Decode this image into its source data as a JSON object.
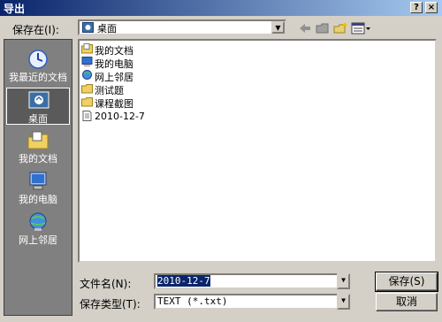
{
  "window": {
    "title": "导出",
    "help": "?",
    "close": "×"
  },
  "location": {
    "label": "保存在(I):",
    "value": "桌面"
  },
  "places": [
    {
      "label": "我最近的文档",
      "icon": "recent-docs-icon"
    },
    {
      "label": "桌面",
      "icon": "desktop-icon"
    },
    {
      "label": "我的文档",
      "icon": "my-documents-icon"
    },
    {
      "label": "我的电脑",
      "icon": "my-computer-icon"
    },
    {
      "label": "网上邻居",
      "icon": "network-icon"
    }
  ],
  "files": [
    {
      "name": "我的文档",
      "icon": "folder-docs-icon"
    },
    {
      "name": "我的电脑",
      "icon": "computer-icon"
    },
    {
      "name": "网上邻居",
      "icon": "network-icon"
    },
    {
      "name": "测试题",
      "icon": "folder-icon"
    },
    {
      "name": "课程截图",
      "icon": "folder-icon"
    },
    {
      "name": "2010-12-7",
      "icon": "text-file-icon"
    }
  ],
  "filename": {
    "label": "文件名(N):",
    "value": "2010-12-7"
  },
  "filetype": {
    "label": "保存类型(T):",
    "value": "TEXT (*.txt)"
  },
  "buttons": {
    "save": "保存(S)",
    "cancel": "取消"
  },
  "colors": {
    "titlebar": "#0a246a",
    "face": "#d4d0c8",
    "places_bg": "#808080"
  }
}
